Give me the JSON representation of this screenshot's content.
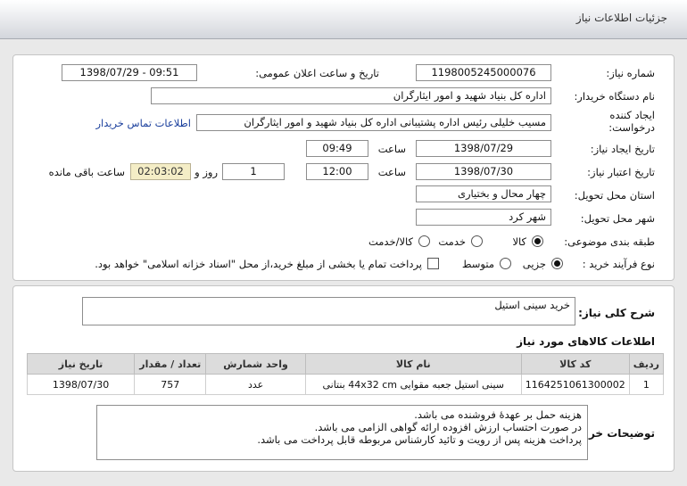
{
  "header": {
    "title": "جزئیات اطلاعات نیاز"
  },
  "form": {
    "need_number_label": "شماره نیاز:",
    "need_number": "1198005245000076",
    "announce_label": "تاریخ و ساعت اعلان عمومی:",
    "announce_value": "1398/07/29 - 09:51",
    "buyer_label": "نام دستگاه خریدار:",
    "buyer_value": "اداره کل بنیاد شهید و امور ایثارگران",
    "creator_label_1": "ایجاد کننده",
    "creator_label_2": "درخواست:",
    "creator_value": "مسیب خلیلی رئیس اداره پشتیبانی اداره کل بنیاد شهید و امور ایثارگران",
    "contact_link": "اطلاعات تماس خریدار",
    "created_date_label": "تاریخ ایجاد نیاز:",
    "created_date": "1398/07/29",
    "time_label": "ساعت",
    "created_time": "09:49",
    "validity_label": "تاریخ اعتبار نیاز:",
    "validity_date": "1398/07/30",
    "validity_time": "12:00",
    "days_value": "1",
    "day_label": "روز و",
    "remaining_value": "02:03:02",
    "remaining_label": "ساعت باقی مانده",
    "province_label": "استان محل تحویل:",
    "province_value": "چهار محال و بختیاری",
    "city_label": "شهر محل تحویل:",
    "city_value": "شهر کرد",
    "category_label": "طبقه بندی موضوعی:",
    "category_options": [
      "کالا",
      "خدمت",
      "کالا/خدمت"
    ],
    "process_label": "نوع فرآیند خرید :",
    "process_options": [
      "جزیی",
      "متوسط"
    ],
    "payment_note": "پرداخت تمام یا بخشی از مبلغ خرید،از محل \"اسناد خزانه اسلامی\" خواهد بود."
  },
  "details": {
    "summary_label": "شرح کلی نیاز:",
    "summary_value": "خرید سینی استیل",
    "goods_title": "اطلاعات کالاهای مورد نیاز",
    "table_headers": [
      "ردیف",
      "کد کالا",
      "نام کالا",
      "واحد شمارش",
      "تعداد / مقدار",
      "تاریخ نیاز"
    ],
    "rows": [
      [
        "1",
        "1164251061300002",
        "سینی استیل جعبه مقوایی 44x32 cm بنتانی",
        "عدد",
        "757",
        "1398/07/30"
      ]
    ],
    "buyer_desc_label": "توضیحات خریدار:",
    "buyer_desc_lines": [
      "هزینه حمل بر عهدۀ فروشنده می باشد.",
      "در صورت احتساب ارزش افزوده ارائه گواهی الزامی می باشد.",
      "پرداخت هزینه پس از رویت و تائید کارشناس مربوطه قابل پرداخت می باشد."
    ]
  }
}
